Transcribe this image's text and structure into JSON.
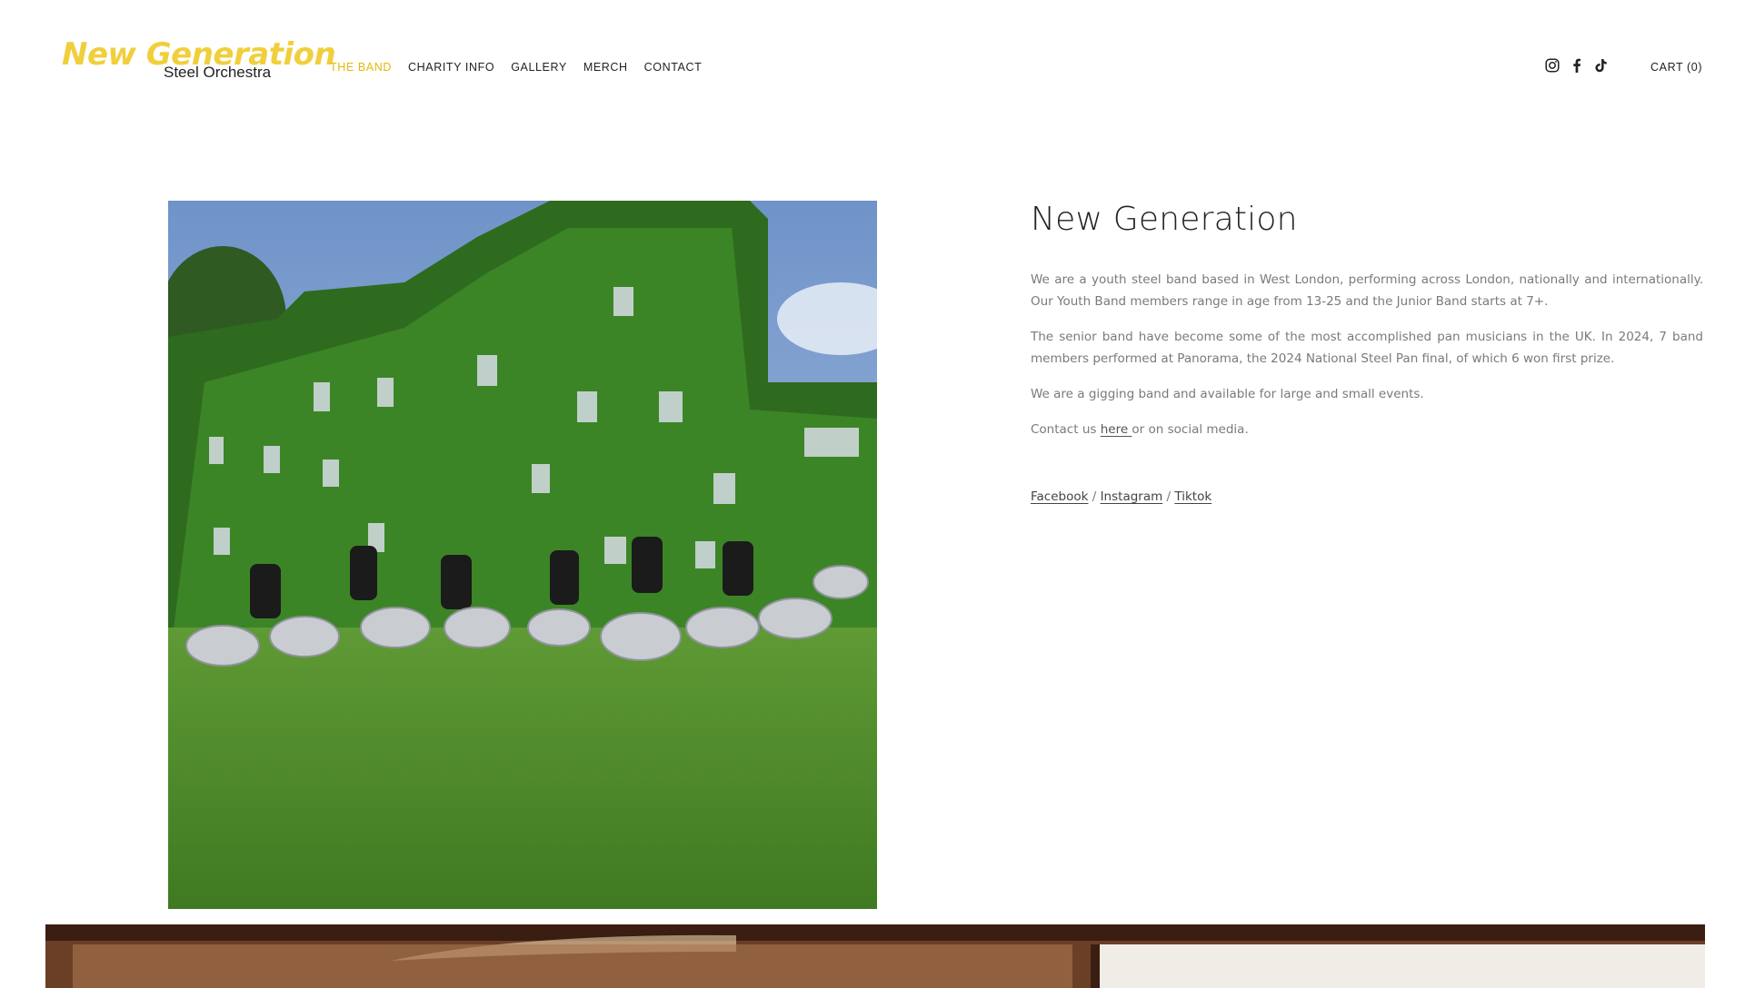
{
  "header": {
    "logo_line1": "New Generation",
    "logo_line2": "Steel Orchestra",
    "nav": [
      {
        "label": "THE BAND",
        "active": true
      },
      {
        "label": "CHARITY INFO",
        "active": false
      },
      {
        "label": "GALLERY",
        "active": false
      },
      {
        "label": "MERCH",
        "active": false
      },
      {
        "label": "CONTACT",
        "active": false
      }
    ],
    "social_icons": [
      "instagram-icon",
      "facebook-icon",
      "tiktok-icon"
    ],
    "cart_label": "CART (0)"
  },
  "colors": {
    "accent": "#e6b80c",
    "logo_yellow": "#f1cf3c",
    "text": "#222222",
    "body_text": "#7a7a7a"
  },
  "main": {
    "title": "New Generation",
    "paragraphs": [
      "We are a youth steel band based in West London, performing across London, nationally and internationally. Our Youth Band members range in age from 13-25 and the Junior Band starts at 7+.",
      "The senior band have become some of the most accomplished pan musicians in the UK. In 2024, 7 band members performed at Panorama, the 2024 National Steel Pan final, of which 6 won first prize.",
      "We are a gigging band and available for large and small events."
    ],
    "contact_prefix": "Contact us ",
    "contact_link": "here ",
    "contact_suffix": "or on social media.",
    "social_links": {
      "facebook": "Facebook",
      "instagram": "Instagram",
      "tiktok": "Tiktok",
      "separator": " / "
    }
  }
}
